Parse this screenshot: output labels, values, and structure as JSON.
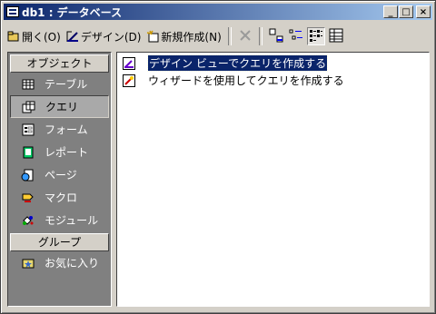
{
  "window": {
    "title": "db1 : データベース",
    "controls": {
      "minimize": "_",
      "maximize": "□",
      "close": "×"
    }
  },
  "toolbar": {
    "open_label": "開く(O)",
    "design_label": "デザイン(D)",
    "new_label": "新規作成(N)"
  },
  "sidebar": {
    "objects_header": "オブジェクト",
    "items": [
      {
        "label": "テーブル",
        "icon": "table-icon"
      },
      {
        "label": "クエリ",
        "icon": "query-icon",
        "selected": true
      },
      {
        "label": "フォーム",
        "icon": "form-icon"
      },
      {
        "label": "レポート",
        "icon": "report-icon"
      },
      {
        "label": "ページ",
        "icon": "page-icon"
      },
      {
        "label": "マクロ",
        "icon": "macro-icon"
      },
      {
        "label": "モジュール",
        "icon": "module-icon"
      }
    ],
    "groups_header": "グループ",
    "favorites_label": "お気に入り"
  },
  "list": {
    "items": [
      {
        "label": "デザイン ビューでクエリを作成する",
        "selected": true
      },
      {
        "label": "ウィザードを使用してクエリを作成する",
        "selected": false
      }
    ]
  },
  "colors": {
    "title_start": "#0a246a",
    "title_end": "#a6caf0",
    "face": "#d4d0c8",
    "sidebar_bg": "#808080",
    "selection": "#0a246a"
  }
}
